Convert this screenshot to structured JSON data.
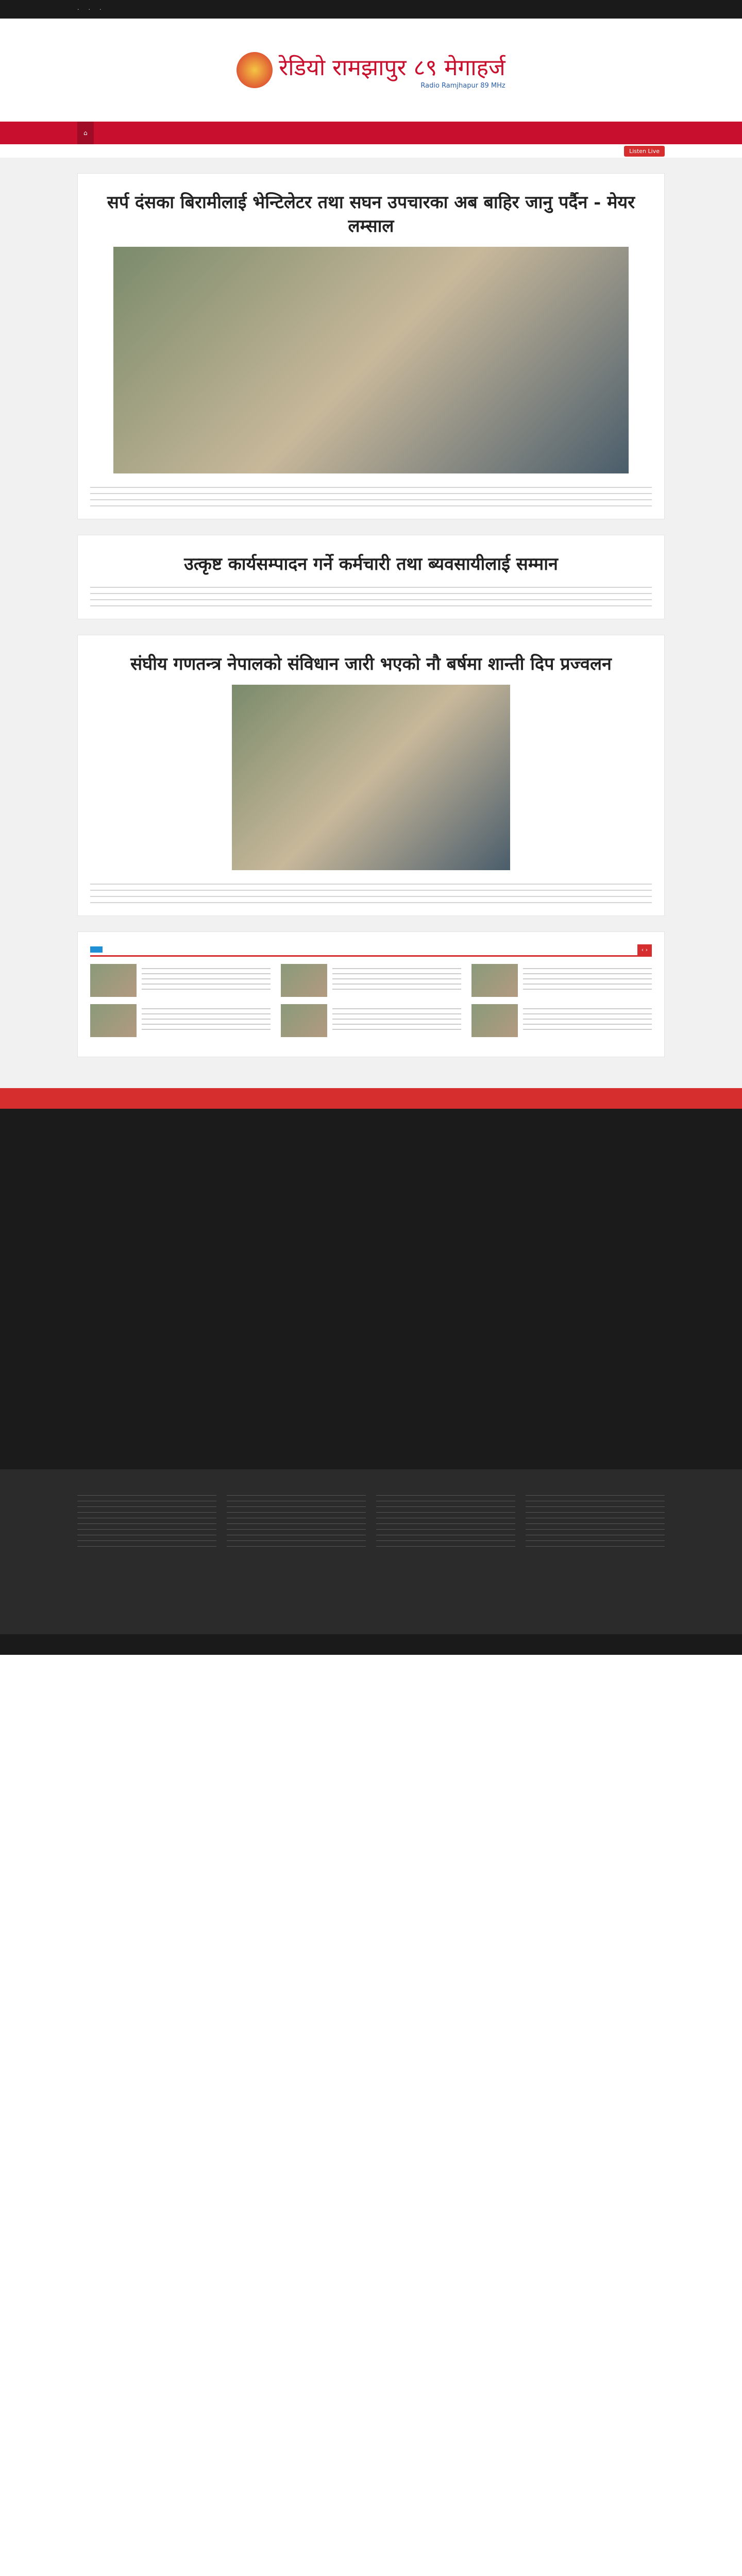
{
  "header": {
    "logo_text": "रेडियो रामझापुर ८९ मेगाहर्ज",
    "logo_sub": "Radio Ramjhapur 89 MHz"
  },
  "nav": {
    "live_label": "Listen Live"
  },
  "colors": {
    "brand_red": "#c8102e",
    "accent_blue": "#1f8fd6",
    "dark": "#1a1a1a"
  },
  "featured": [
    {
      "title": "सर्प दंसका बिरामीलाई भेन्टिलेटर तथा सघन उपचारका अब बाहिर जानु पर्दैन - मेयर लम्साल"
    },
    {
      "title": "उत्कृष्ट कार्यसम्पादन गर्ने कर्मचारी तथा ब्यवसायीलाई सम्मान"
    },
    {
      "title": "संघीय गणतन्त्र नेपालको संविधान जारी भएको नौ बर्षमा शान्ती दिप प्रज्वलन"
    }
  ]
}
